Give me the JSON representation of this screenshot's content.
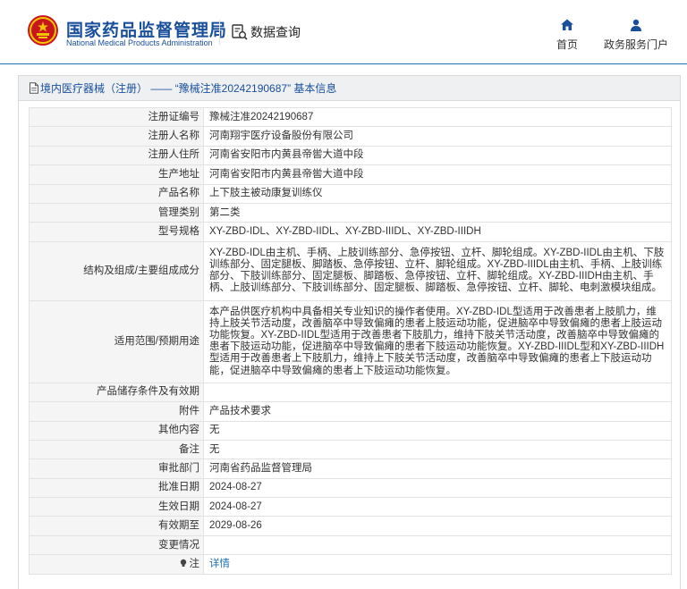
{
  "header": {
    "brand_cn": "国家药品监督管理局",
    "brand_en": "National Medical Products Administration",
    "query_label": "数据查询",
    "nav": {
      "home_label": "首页",
      "portal_label": "政务服务门户"
    }
  },
  "panel": {
    "breadcrumb": "境内医疗器械（注册） —— “豫械注准20242190687” 基本信息"
  },
  "rows": [
    {
      "label": "注册证编号",
      "value": "豫械注准20242190687"
    },
    {
      "label": "注册人名称",
      "value": "河南翔宇医疗设备股份有限公司"
    },
    {
      "label": "注册人住所",
      "value": "河南省安阳市内黄县帝喾大道中段"
    },
    {
      "label": "生产地址",
      "value": "河南省安阳市内黄县帝喾大道中段"
    },
    {
      "label": "产品名称",
      "value": "上下肢主被动康复训练仪"
    },
    {
      "label": "管理类别",
      "value": "第二类"
    },
    {
      "label": "型号规格",
      "value": "XY-ZBD-IDL、XY-ZBD-IIDL、XY-ZBD-IIIDL、XY-ZBD-IIIDH"
    },
    {
      "label": "结构及组成/主要组成成分",
      "value": "XY-ZBD-IDL由主机、手柄、上肢训练部分、急停按钮、立杆、脚轮组成。XY-ZBD-IIDL由主机、下肢训练部分、固定腿板、脚踏板、急停按钮、立杆、脚轮组成。XY-ZBD-IIIDL由主机、手柄、上肢训练部分、下肢训练部分、固定腿板、脚踏板、急停按钮、立杆、脚轮组成。XY-ZBD-IIIDH由主机、手柄、上肢训练部分、下肢训练部分、固定腿板、脚踏板、急停按钮、立杆、脚轮、电刺激模块组成。"
    },
    {
      "label": "适用范围/预期用途",
      "value": "本产品供医疗机构中具备相关专业知识的操作者使用。XY-ZBD-IDL型适用于改善患者上肢肌力，维持上肢关节活动度，改善脑卒中导致偏瘫的患者上肢运动功能，促进脑卒中导致偏瘫的患者上肢运动功能恢复。XY-ZBD-IIDL型适用于改善患者下肢肌力，维持下肢关节活动度，改善脑卒中导致偏瘫的患者下肢运动功能，促进脑卒中导致偏瘫的患者下肢运动功能恢复。XY-ZBD-IIIDL型和XY-ZBD-IIIDH型适用于改善患者上下肢肌力，维持上下肢关节活动度，改善脑卒中导致偏瘫的患者上下肢运动功能，促进脑卒中导致偏瘫的患者上下肢运动功能恢复。"
    },
    {
      "label": "产品储存条件及有效期",
      "value": ""
    },
    {
      "label": "附件",
      "value": "产品技术要求"
    },
    {
      "label": "其他内容",
      "value": "无"
    },
    {
      "label": "备注",
      "value": "无"
    },
    {
      "label": "审批部门",
      "value": "河南省药品监督管理局"
    },
    {
      "label": "批准日期",
      "value": "2024-08-27"
    },
    {
      "label": "生效日期",
      "value": "2024-08-27"
    },
    {
      "label": "有效期至",
      "value": "2029-08-26"
    },
    {
      "label": "变更情况",
      "value": ""
    },
    {
      "label": "注",
      "value": "详情"
    }
  ],
  "colors": {
    "brand": "#1a4f9c",
    "link": "#1f6fb5",
    "label_bg": "#f5f5f5"
  },
  "icons": {
    "logo": "national-emblem-icon",
    "query": "data-search-icon",
    "home": "home-icon",
    "portal": "user-icon",
    "breadcrumb": "document-icon",
    "note": "bulb-icon"
  }
}
